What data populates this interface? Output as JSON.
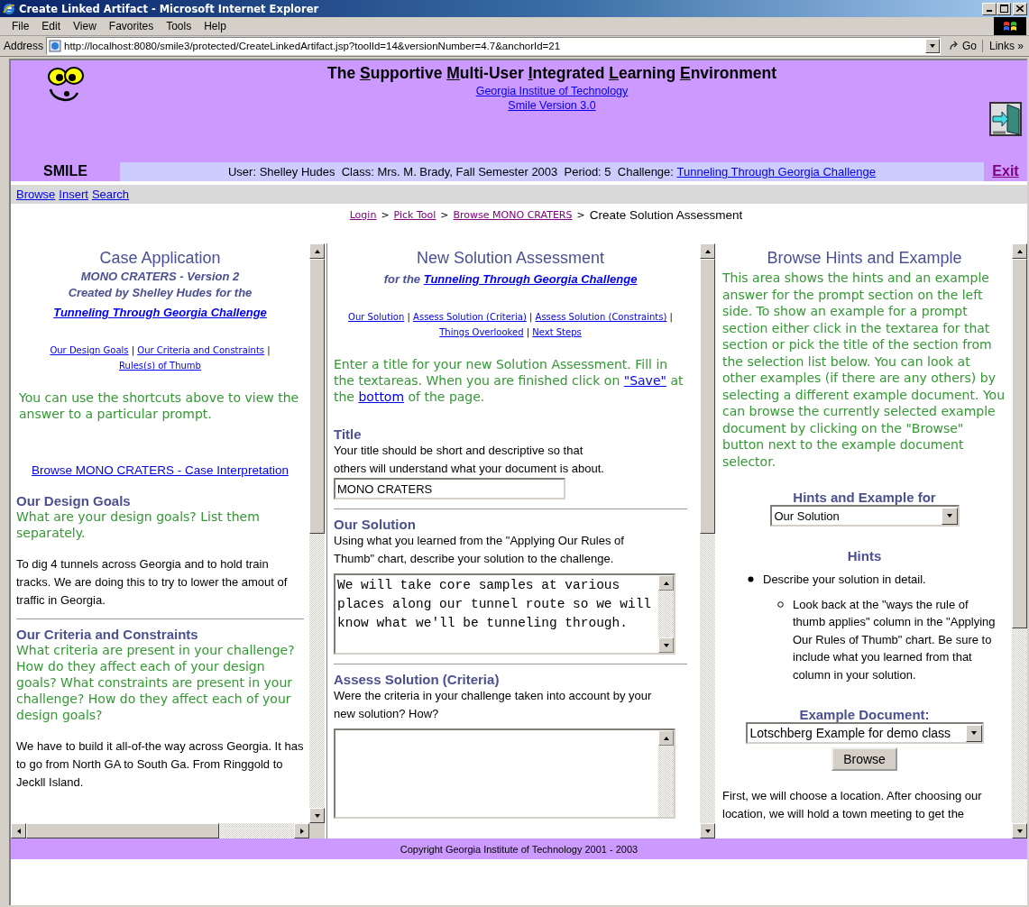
{
  "window": {
    "title": "Create Linked Artifact - Microsoft Internet Explorer"
  },
  "menu": [
    {
      "label": "File"
    },
    {
      "label": "Edit"
    },
    {
      "label": "View"
    },
    {
      "label": "Favorites"
    },
    {
      "label": "Tools"
    },
    {
      "label": "Help"
    }
  ],
  "address_bar": {
    "label": "Address",
    "url": "http://localhost:8080/smile3/protected/CreateLinkedArtifact.jsp?toolId=14&versionNumber=4.7&anchorId=21",
    "go": "Go",
    "links": "Links »"
  },
  "header": {
    "logo_label": "SMILE",
    "title_parts": [
      {
        "text": "The ",
        "underline": false
      },
      {
        "text": "S",
        "underline": true
      },
      {
        "text": "upportive ",
        "underline": false
      },
      {
        "text": "M",
        "underline": true
      },
      {
        "text": "ulti-User ",
        "underline": false
      },
      {
        "text": "I",
        "underline": true
      },
      {
        "text": "ntegrated ",
        "underline": false
      },
      {
        "text": "L",
        "underline": true
      },
      {
        "text": "earning ",
        "underline": false
      },
      {
        "text": "E",
        "underline": true
      },
      {
        "text": "nvironment",
        "underline": false
      }
    ],
    "institution": "Georgia Institue of Technology",
    "version": "Smile Version 3.0",
    "user_info": "User: Shelley Hudes  Class: Mrs. M. Brady, Fall Semester 2003  Period: 5  Challenge: ",
    "challenge": "Tunneling Through Georgia Challenge",
    "exit": "Exit"
  },
  "toolbar": [
    {
      "label": "Browse"
    },
    {
      "label": "Insert"
    },
    {
      "label": "Search"
    }
  ],
  "breadcrumb": {
    "separator": ">",
    "links": [
      {
        "label": "Login"
      },
      {
        "label": "Pick Tool"
      },
      {
        "label": "Browse MONO CRATERS"
      }
    ],
    "current": "Create Solution Assessment"
  },
  "left_frame": {
    "heading": "Case Application",
    "subtitle": "MONO CRATERS - Version 2",
    "byline": "Created by Shelley Hudes for the",
    "byline_link": "Tunneling Through Georgia Challenge",
    "shortcuts": [
      {
        "label": "Our Design Goals"
      },
      {
        "label": "Our Criteria and Constraints"
      },
      {
        "label": "Rules(s) of Thumb"
      }
    ],
    "shortcut_separator": "|",
    "instruction": "You can use the shortcuts above to view the answer to a particular prompt.",
    "browse_link": "Browse MONO CRATERS - Case Interpretation",
    "sections": [
      {
        "title": "Our Design Goals",
        "prompt": "What are your design goals? List them separately.",
        "answer": "To dig 4 tunnels across Georgia and to hold train tracks. We are doing this to try to lower the amout of traffic in Georgia."
      },
      {
        "title": "Our Criteria and Constraints",
        "prompt": "What criteria are present in your challenge? How do they affect each of your design goals? What constraints are present in your challenge? How do they affect each of your design goals?",
        "answer": "We have to build it all-of-the way across Georgia. It has to go from North GA to South Ga. From Ringgold to Jeckll Island."
      }
    ]
  },
  "middle_frame": {
    "heading": "New Solution Assessment",
    "subtitle": "for the",
    "subtitle_link": "Tunneling Through Georgia Challenge",
    "shortcuts": [
      {
        "label": "Our Solution"
      },
      {
        "label": "Assess Solution (Criteria)"
      },
      {
        "label": "Assess Solution (Constraints)"
      },
      {
        "label": "Things Overlooked"
      },
      {
        "label": "Next Steps"
      }
    ],
    "shortcut_separator": "|",
    "instruction": [
      {
        "kind": "text",
        "text": "Enter a title for your new Solution Assessment. Fill in the textareas. When you are finished click on "
      },
      {
        "kind": "link",
        "text": "\"Save\""
      },
      {
        "kind": "text",
        "text": " at the "
      },
      {
        "kind": "link",
        "text": "bottom"
      },
      {
        "kind": "text",
        "text": " of the page."
      }
    ],
    "fields": [
      {
        "kind": "input",
        "title": "Title",
        "description": "Your title should be short and descriptive so that others will understand what your document is about.",
        "value": "MONO CRATERS"
      },
      {
        "kind": "textarea",
        "title": "Our Solution",
        "description": "Using what you learned from the \"Applying Our Rules of Thumb\" chart, describe your solution to the challenge.",
        "value": "We will take core samples at various places along our tunnel route so we will know what we'll be tunneling through."
      },
      {
        "kind": "textarea",
        "title": "Assess Solution (Criteria)",
        "description": "Were the criteria in your challenge taken into account by your new solution? How?"
      }
    ]
  },
  "right_frame": {
    "heading": "Browse Hints and Example",
    "intro": "This area shows the hints and an example answer for the prompt section on the left side. To show an example for a prompt section either click in the textarea for that section or pick the title of the section from the selection list below. You can look at other examples (if there are any others) by selecting a different example document. You can browse the currently selected example document by clicking on the \"Browse\" button next to the example document selector.",
    "hints_for_label": "Hints and Example for",
    "hints_for_value": "Our Solution",
    "hints_heading": "Hints",
    "hints": [
      {
        "text": "Describe your solution in detail.",
        "children": [
          {
            "text": "Look back at the \"ways the rule of thumb applies\" column in the \"Applying Our Rules of Thumb\" chart. Be sure to include what you learned from that column in your solution."
          }
        ]
      }
    ],
    "example_label": "Example Document:",
    "example_value": "Lotschberg Example for demo class",
    "browse_button": "Browse",
    "example_text": "First, we will choose a location. After choosing our location, we will hold a town meeting to get the"
  },
  "footer": "Copyright Georgia Institute of Technology 2001 - 2003"
}
